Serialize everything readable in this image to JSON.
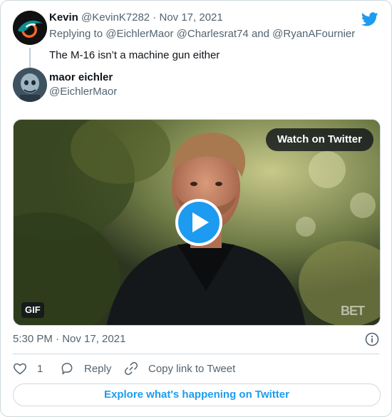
{
  "parent_tweet": {
    "author_name": "Kevin",
    "handle": "@KevinK7282",
    "separator": "·",
    "date": "Nov 17, 2021",
    "replying_prefix": "Replying to",
    "mention_1": "@EichlerMaor",
    "mention_2": "@Charlesrat74",
    "mention_join": "and",
    "mention_3": "@RyanAFournier",
    "text": "The M-16 isn’t a machine gun either"
  },
  "main_tweet": {
    "author_name": "maor eichler",
    "handle": "@EichlerMaor",
    "media": {
      "watch_label": "Watch on Twitter",
      "gif_badge": "GIF",
      "watermark": "BET"
    },
    "timestamp": "5:30 PM · Nov 17, 2021",
    "actions": {
      "like_count": "1",
      "reply_label": "Reply",
      "copy_link_label": "Copy link to Tweet"
    },
    "explore_label": "Explore what's happening on Twitter"
  },
  "colors": {
    "accent": "#1d9bf0",
    "text_primary": "#0f1419",
    "text_secondary": "#536471",
    "border": "#cfd9de"
  },
  "icons": [
    "twitter-bird-icon",
    "play-icon",
    "info-icon",
    "heart-icon",
    "reply-bubble-icon",
    "link-icon"
  ]
}
